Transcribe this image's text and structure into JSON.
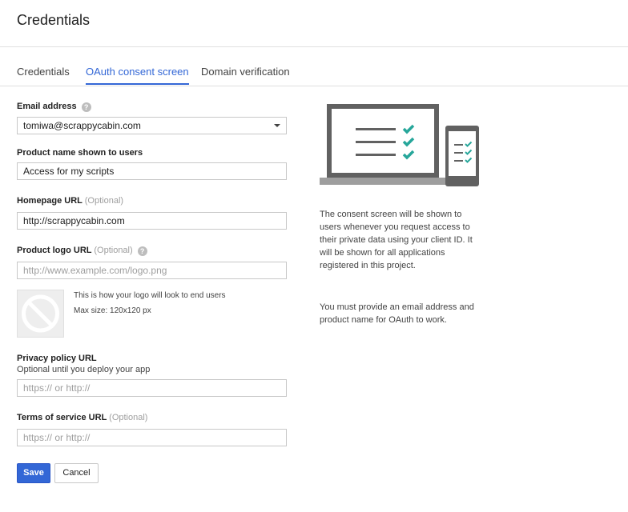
{
  "header": {
    "title": "Credentials"
  },
  "tabs": [
    {
      "label": "Credentials",
      "active": false
    },
    {
      "label": "OAuth consent screen",
      "active": true
    },
    {
      "label": "Domain verification",
      "active": false
    }
  ],
  "form": {
    "email": {
      "label": "Email address",
      "value": "tomiwa@scrappycabin.com"
    },
    "product_name": {
      "label": "Product name shown to users",
      "value": "Access for my scripts"
    },
    "homepage": {
      "label": "Homepage URL",
      "optional": "(Optional)",
      "value": "http://scrappycabin.com"
    },
    "logo": {
      "label": "Product logo URL",
      "optional": "(Optional)",
      "placeholder": "http://www.example.com/logo.png",
      "note1": "This is how your logo will look to end users",
      "note2": "Max size: 120x120 px"
    },
    "privacy": {
      "label": "Privacy policy URL",
      "sublabel": "Optional until you deploy your app",
      "placeholder": "https:// or http://"
    },
    "terms": {
      "label": "Terms of service URL",
      "optional": "(Optional)",
      "placeholder": "https:// or http://"
    }
  },
  "buttons": {
    "save": "Save",
    "cancel": "Cancel"
  },
  "info": {
    "para1": "The consent screen will be shown to users whenever you request access to their private data using your client ID. It will be shown for all applications registered in this project.",
    "para2": "You must provide an email address and product name for OAuth to work."
  },
  "colors": {
    "accent": "#3367d6",
    "check": "#26a69a",
    "device": "#616161"
  }
}
